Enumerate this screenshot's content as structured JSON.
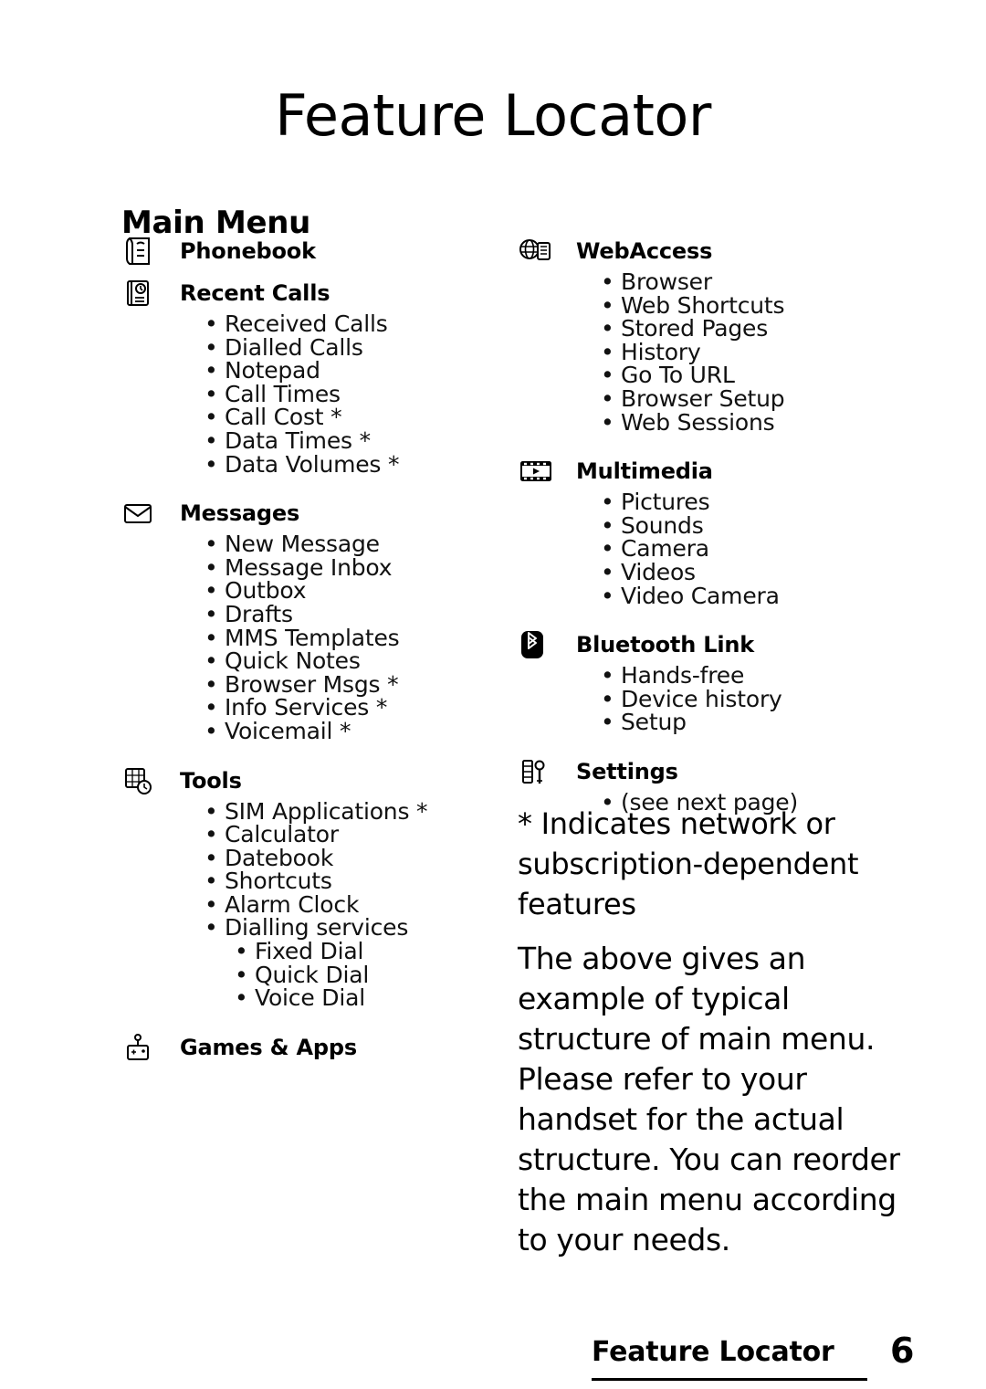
{
  "page": {
    "title": "Feature Locator",
    "section_title": "Main Menu",
    "footer_label": "Feature Locator",
    "footer_page": "6"
  },
  "left_column": [
    {
      "icon": "phonebook-icon",
      "label": "Phonebook",
      "items": []
    },
    {
      "icon": "recent-calls-icon",
      "label": "Recent Calls",
      "items": [
        "Received Calls",
        "Dialled Calls",
        "Notepad",
        "Call Times",
        "Call Cost *",
        "Data Times *",
        "Data Volumes *"
      ]
    },
    {
      "icon": "envelope-icon",
      "label": "Messages",
      "items": [
        "New Message",
        "Message Inbox",
        "Outbox",
        "Drafts",
        "MMS Templates",
        "Quick Notes",
        "Browser Msgs *",
        "Info Services *",
        "Voicemail *"
      ]
    },
    {
      "icon": "tools-icon",
      "label": "Tools",
      "items": [
        "SIM Applications *",
        "Calculator",
        "Datebook",
        "Shortcuts",
        "Alarm Clock",
        "Dialling services"
      ],
      "sub_items": [
        "Fixed Dial",
        "Quick Dial",
        "Voice Dial"
      ]
    },
    {
      "icon": "games-icon",
      "label": "Games & Apps",
      "items": []
    }
  ],
  "right_column": [
    {
      "icon": "webaccess-icon",
      "label": "WebAccess",
      "items": [
        "Browser",
        "Web Shortcuts",
        "Stored Pages",
        "History",
        "Go To URL",
        "Browser Setup",
        "Web Sessions"
      ]
    },
    {
      "icon": "multimedia-icon",
      "label": "Multimedia",
      "items": [
        "Pictures",
        "Sounds",
        "Camera",
        "Videos",
        "Video Camera"
      ]
    },
    {
      "icon": "bluetooth-icon",
      "label": "Bluetooth Link",
      "items": [
        "Hands-free",
        "Device history",
        "Setup"
      ]
    },
    {
      "icon": "settings-icon",
      "label": "Settings",
      "items": [
        "(see next page)"
      ]
    }
  ],
  "note": "* Indicates network or subscription-dependent features",
  "body_text": "The above gives an example of typical structure of main menu. Please refer to your handset for the actual structure. You can reorder the main menu according to your needs.",
  "bullet_glyph": "•"
}
